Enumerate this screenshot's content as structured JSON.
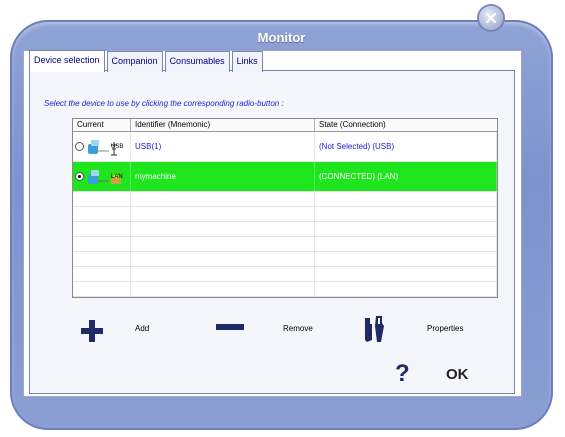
{
  "window": {
    "title": "Monitor"
  },
  "tabs": [
    {
      "label": "Device selection",
      "active": true
    },
    {
      "label": "Companion",
      "active": false
    },
    {
      "label": "Consumables",
      "active": false
    },
    {
      "label": "Links",
      "active": false
    }
  ],
  "instruction": "Select the device to use by clicking the corresponding radio-button :",
  "table": {
    "headers": [
      "Current",
      "Identifier (Mnemonic)",
      "State (Connection)"
    ],
    "rows": [
      {
        "conn": "USB",
        "identifier": "USB(1)",
        "state": "(Not Selected) (USB)",
        "checked": false
      },
      {
        "conn": "LAN",
        "identifier": "mymachine",
        "state": "(CONNECTED) (LAN)",
        "checked": true
      }
    ]
  },
  "actions": {
    "add_label": "Add",
    "remove_label": "Remove",
    "properties_label": "Properties"
  },
  "dialog": {
    "help_label": "?",
    "ok_label": "OK"
  },
  "colors": {
    "selected_row": "#1fe51f",
    "window_frame": "#8fa3d6",
    "link_text": "#1a1ad6"
  }
}
